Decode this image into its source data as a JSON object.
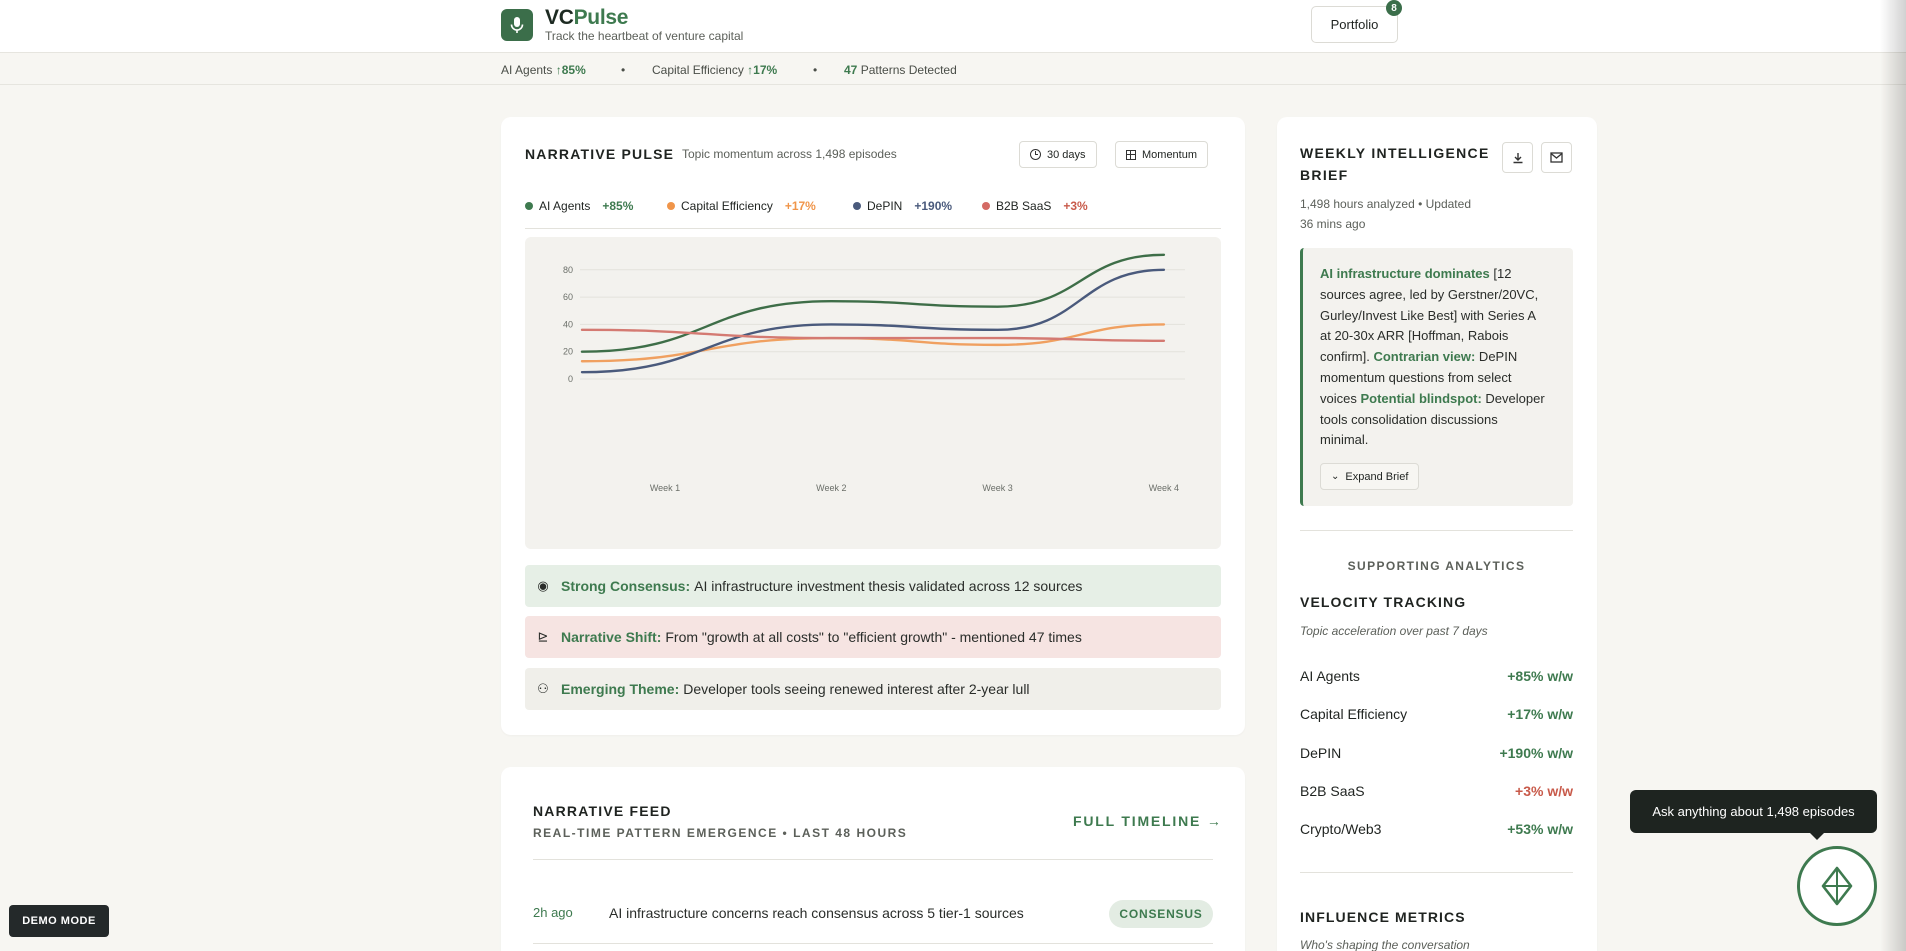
{
  "header": {
    "brand_prefix": "VC",
    "brand_suffix": "Pulse",
    "tagline": "Track the heartbeat of venture capital",
    "portfolio_label": "Portfolio",
    "portfolio_count": "8"
  },
  "ticker": {
    "items": [
      {
        "label": "AI Agents",
        "value": "↑85%"
      },
      {
        "label": "Capital Efficiency",
        "value": "↑17%"
      },
      {
        "count": "47",
        "label": "Patterns Detected"
      }
    ],
    "sep": "•"
  },
  "pulse": {
    "title": "NARRATIVE PULSE",
    "subtitle": "Topic momentum across 1,498 episodes",
    "range_label": "30 days",
    "mode_label": "Momentum",
    "legend": [
      {
        "name": "AI Agents",
        "change": "+85%",
        "color": "#3e7a4f",
        "change_color": "#3e7a4f"
      },
      {
        "name": "Capital Efficiency",
        "change": "+17%",
        "color": "#f0954a",
        "change_color": "#f0954a"
      },
      {
        "name": "DePIN",
        "change": "+190%",
        "color": "#4a5a7c",
        "change_color": "#4a5a7c"
      },
      {
        "name": "B2B SaaS",
        "change": "+3%",
        "color": "#d46a64",
        "change_color": "#c85a4a"
      }
    ],
    "callouts": [
      {
        "label": "Strong Consensus:",
        "text": "AI infrastructure investment thesis validated across 12 sources",
        "icon": "◉",
        "bg": "#e6efe6"
      },
      {
        "label": "Narrative Shift:",
        "text": "From \"growth at all costs\" to \"efficient growth\" - mentioned 47 times",
        "icon": "⊵",
        "bg": "#f6e4e2"
      },
      {
        "label": "Emerging Theme:",
        "text": "Developer tools seeing renewed interest after 2-year lull",
        "icon": "⚇",
        "bg": "#f0efea"
      }
    ]
  },
  "chart_data": {
    "type": "line",
    "categories": [
      "Week 1",
      "Week 2",
      "Week 3",
      "Week 4"
    ],
    "yticks": [
      0,
      20,
      40,
      60,
      80
    ],
    "ylim": [
      0,
      80
    ],
    "series": [
      {
        "name": "AI Agents",
        "color": "#3e6e48",
        "values": [
          20,
          57,
          53,
          91
        ]
      },
      {
        "name": "Capital Efficiency",
        "color": "#f0a060",
        "values": [
          13,
          30,
          25,
          40
        ]
      },
      {
        "name": "DePIN",
        "color": "#4a5a7c",
        "values": [
          5,
          40,
          36,
          80
        ]
      },
      {
        "name": "B2B SaaS",
        "color": "#d47a72",
        "values": [
          36,
          30,
          30,
          28
        ]
      }
    ]
  },
  "feed": {
    "title": "NARRATIVE FEED",
    "subtitle": "REAL-TIME PATTERN EMERGENCE • LAST 48 HOURS",
    "timeline_link": "FULL TIMELINE →",
    "items": [
      {
        "time": "2h ago",
        "text": "AI infrastructure concerns reach consensus across 5 tier-1 sources",
        "tag": "CONSENSUS"
      }
    ]
  },
  "brief": {
    "title_line1": "WEEKLY INTELLIGENCE",
    "title_line2": "BRIEF",
    "meta_line1": "1,498 hours analyzed • Updated",
    "meta_line2": "36 mins ago",
    "body_lines": [
      {
        "strong": "AI infrastructure dominates",
        "text": " [12"
      },
      {
        "text": "sources agree, led by Gerstner/20VC,"
      },
      {
        "text": "Gurley/Invest Like Best] with Series A"
      },
      {
        "text": "at 20-30x ARR [Hoffman, Rabois"
      },
      {
        "text": "confirm].",
        "strong2": " Contrarian view:",
        "tail": " DePIN"
      },
      {
        "text": "momentum questions from select"
      },
      {
        "text": "voices",
        "strong2": " Potential blindspot:",
        "tail": " Developer"
      },
      {
        "text": "tools consolidation discussions"
      },
      {
        "text": "minimal."
      }
    ],
    "expand_label": "Expand Brief"
  },
  "analytics": {
    "heading": "SUPPORTING ANALYTICS",
    "velocity_title": "VELOCITY TRACKING",
    "velocity_sub": "Topic acceleration over past 7 days",
    "rows": [
      {
        "name": "AI Agents",
        "value": "+85% w/w",
        "color": "#3e7a4f"
      },
      {
        "name": "Capital Efficiency",
        "value": "+17% w/w",
        "color": "#3e7a4f"
      },
      {
        "name": "DePIN",
        "value": "+190% w/w",
        "color": "#3e7a4f"
      },
      {
        "name": "B2B SaaS",
        "value": "+3% w/w",
        "color": "#c85a4a"
      },
      {
        "name": "Crypto/Web3",
        "value": "+53% w/w",
        "color": "#3e7a4f"
      }
    ],
    "influence_title": "INFLUENCE METRICS",
    "influence_sub": "Who's shaping the conversation"
  },
  "assistant": {
    "tooltip": "Ask anything about 1,498 episodes"
  },
  "demo_label": "DEMO MODE"
}
